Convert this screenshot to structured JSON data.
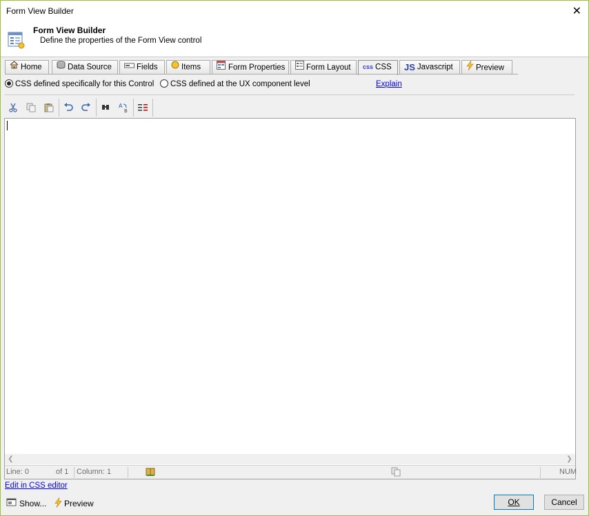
{
  "window": {
    "title": "Form View Builder",
    "close_glyph": "✕"
  },
  "header": {
    "title": "Form View Builder",
    "subtitle": "Define the properties of the Form View control",
    "icon": "form-view-builder-icon"
  },
  "tabs": [
    {
      "label": "Home",
      "icon": "home-icon"
    },
    {
      "label": "Data Source",
      "icon": "database-icon"
    },
    {
      "label": "Fields",
      "icon": "fields-icon"
    },
    {
      "label": "Items",
      "icon": "items-icon"
    },
    {
      "label": "Form Properties",
      "icon": "form-properties-icon"
    },
    {
      "label": "Form Layout",
      "icon": "form-layout-icon"
    },
    {
      "label": "CSS",
      "icon_text": "css",
      "icon": "css-icon",
      "active": true
    },
    {
      "label": "Javascript",
      "icon_text": "JS",
      "icon": "javascript-icon"
    },
    {
      "label": "Preview",
      "icon": "lightning-icon"
    }
  ],
  "css_scope": {
    "options": [
      {
        "label": "CSS defined specifically for this Control",
        "selected": true
      },
      {
        "label": "CSS defined at the UX component level",
        "selected": false
      }
    ],
    "explain_link": "Explain"
  },
  "toolbar": {
    "buttons": [
      "cut-icon",
      "copy-icon",
      "paste-icon",
      "undo-icon",
      "redo-icon",
      "find-icon",
      "replace-icon",
      "indent-icon"
    ]
  },
  "editor": {
    "content": "",
    "status": {
      "line": "Line: 0",
      "of": "of 1",
      "column": "Column: 1",
      "num": "NUM"
    }
  },
  "footer": {
    "edit_link": "Edit in CSS editor",
    "show_label": "Show...",
    "preview_label": "Preview",
    "ok_label": "OK",
    "cancel_label": "Cancel"
  },
  "colors": {
    "window_border": "#9bbf3f",
    "link": "#0000ee",
    "default_button_border": "#0078d7"
  }
}
